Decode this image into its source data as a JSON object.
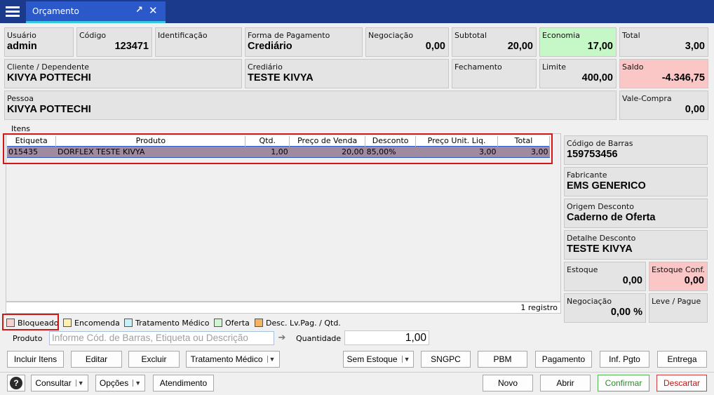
{
  "tab": {
    "title": "Orçamento",
    "pin_icon": "↗",
    "close_icon": "✕"
  },
  "header_fields": {
    "usuario": {
      "label": "Usuário",
      "value": "admin"
    },
    "codigo": {
      "label": "Código",
      "value": "123471"
    },
    "identificacao": {
      "label": "Identificação",
      "value": ""
    },
    "forma_pagamento": {
      "label": "Forma de Pagamento",
      "value": "Crediário"
    },
    "negociacao": {
      "label": "Negociação",
      "value": "0,00"
    },
    "subtotal": {
      "label": "Subtotal",
      "value": "20,00"
    },
    "economia": {
      "label": "Economia",
      "value": "17,00"
    },
    "total": {
      "label": "Total",
      "value": "3,00"
    },
    "cliente": {
      "label": "Cliente / Dependente",
      "value": "KIVYA POTTECHI"
    },
    "crediario": {
      "label": "Crediário",
      "value": "TESTE KIVYA"
    },
    "fechamento": {
      "label": "Fechamento",
      "value": ""
    },
    "limite": {
      "label": "Limite",
      "value": "400,00"
    },
    "saldo": {
      "label": "Saldo",
      "value": "-4.346,75"
    },
    "pessoa": {
      "label": "Pessoa",
      "value": "KIVYA POTTECHI"
    },
    "vale_compra": {
      "label": "Vale-Compra",
      "value": "0,00"
    }
  },
  "items": {
    "group_label": "Itens",
    "columns": [
      "Etiqueta",
      "Produto",
      "Qtd.",
      "Preço de Venda",
      "Desconto",
      "Preço Unit. Liq.",
      "Total"
    ],
    "rows": [
      {
        "etiqueta": "015435",
        "produto": "DORFLEX TESTE KIVYA",
        "qtd": "1,00",
        "preco_venda": "20,00",
        "desconto": "85,00%",
        "preco_unit_liq": "3,00",
        "total": "3,00"
      }
    ],
    "count_text": "1 registro"
  },
  "side_fields": {
    "codigo_barras": {
      "label": "Código de Barras",
      "value": "159753456"
    },
    "fabricante": {
      "label": "Fabricante",
      "value": "EMS GENERICO"
    },
    "origem_desconto": {
      "label": "Origem Desconto",
      "value": "Caderno de Oferta"
    },
    "detalhe_desconto": {
      "label": "Detalhe Desconto",
      "value": "TESTE KIVYA"
    },
    "estoque": {
      "label": "Estoque",
      "value": "0,00"
    },
    "estoque_conf": {
      "label": "Estoque Conf.",
      "value": "0,00"
    },
    "negociacao": {
      "label": "Negociação",
      "value": "0,00 %"
    },
    "leve_pague": {
      "label": "Leve / Pague",
      "value": ""
    }
  },
  "legend": [
    {
      "label": "Bloqueado",
      "color": "#f8d0d0"
    },
    {
      "label": "Encomenda",
      "color": "#fdf0b0"
    },
    {
      "label": "Tratamento Médico",
      "color": "#c8f0f8"
    },
    {
      "label": "Oferta",
      "color": "#d0f5d0"
    },
    {
      "label": "Desc. Lv.Pag. / Qtd.",
      "color": "#f5b560"
    }
  ],
  "product_entry": {
    "label": "Produto",
    "placeholder": "Informe Cód. de Barras, Etiqueta ou Descrição",
    "qty_label": "Quantidade",
    "qty_value": "1,00"
  },
  "action_buttons": {
    "incluir_itens": "Incluir Itens",
    "editar": "Editar",
    "excluir": "Excluir",
    "tratamento_medico": "Tratamento Médico",
    "sem_estoque": "Sem Estoque",
    "sngpc": "SNGPC",
    "pbm": "PBM",
    "pagamento": "Pagamento",
    "inf_pgto": "Inf. Pgto",
    "entrega": "Entrega"
  },
  "bottom_buttons": {
    "help_icon": "?",
    "consultar": "Consultar",
    "opcoes": "Opções",
    "atendimento": "Atendimento",
    "novo": "Novo",
    "abrir": "Abrir",
    "confirmar": "Confirmar",
    "descartar": "Descartar"
  },
  "dropdown_glyph": "▼"
}
